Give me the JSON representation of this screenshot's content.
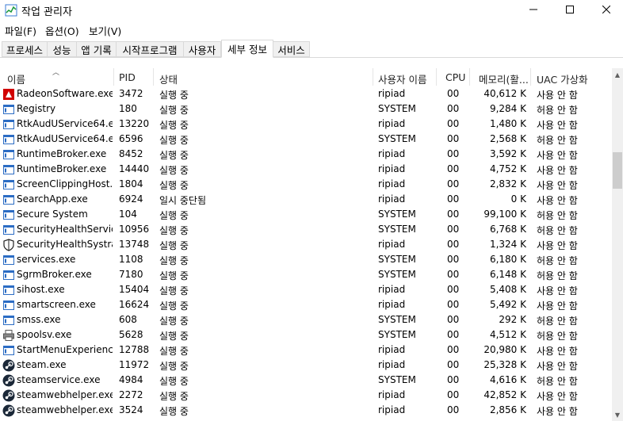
{
  "window": {
    "title": "작업 관리자",
    "minimize_icon": "minimize-icon",
    "maximize_icon": "maximize-icon",
    "close_icon": "close-icon"
  },
  "menu": [
    "파일(F)",
    "옵션(O)",
    "보기(V)"
  ],
  "tabs": [
    "프로세스",
    "성능",
    "앱 기록",
    "시작프로그램",
    "사용자",
    "세부 정보",
    "서비스"
  ],
  "active_tab": "세부 정보",
  "columns": {
    "name": "이름",
    "pid": "PID",
    "status": "상태",
    "user": "사용자 이름",
    "cpu": "CPU",
    "memory": "메모리(활...",
    "uac": "UAC 가상화"
  },
  "rows": [
    {
      "icon": "radeon-icon",
      "name": "RadeonSoftware.exe",
      "pid": "3472",
      "status": "실행 중",
      "user": "ripiad",
      "cpu": "00",
      "memory": "40,612 K",
      "uac": "사용 안 함"
    },
    {
      "icon": "window-icon",
      "name": "Registry",
      "pid": "180",
      "status": "실행 중",
      "user": "SYSTEM",
      "cpu": "00",
      "memory": "9,284 K",
      "uac": "허용 안 함"
    },
    {
      "icon": "window-icon",
      "name": "RtkAudUService64.e...",
      "pid": "13220",
      "status": "실행 중",
      "user": "ripiad",
      "cpu": "00",
      "memory": "1,480 K",
      "uac": "사용 안 함"
    },
    {
      "icon": "window-icon",
      "name": "RtkAudUService64.e...",
      "pid": "6596",
      "status": "실행 중",
      "user": "SYSTEM",
      "cpu": "00",
      "memory": "2,568 K",
      "uac": "허용 안 함"
    },
    {
      "icon": "window-icon",
      "name": "RuntimeBroker.exe",
      "pid": "8452",
      "status": "실행 중",
      "user": "ripiad",
      "cpu": "00",
      "memory": "3,592 K",
      "uac": "사용 안 함"
    },
    {
      "icon": "window-icon",
      "name": "RuntimeBroker.exe",
      "pid": "14440",
      "status": "실행 중",
      "user": "ripiad",
      "cpu": "00",
      "memory": "4,752 K",
      "uac": "사용 안 함"
    },
    {
      "icon": "window-icon",
      "name": "ScreenClippingHost....",
      "pid": "1804",
      "status": "실행 중",
      "user": "ripiad",
      "cpu": "00",
      "memory": "2,832 K",
      "uac": "사용 안 함"
    },
    {
      "icon": "window-icon",
      "name": "SearchApp.exe",
      "pid": "6924",
      "status": "일시 중단됨",
      "user": "ripiad",
      "cpu": "00",
      "memory": "0 K",
      "uac": "사용 안 함"
    },
    {
      "icon": "window-icon",
      "name": "Secure System",
      "pid": "104",
      "status": "실행 중",
      "user": "SYSTEM",
      "cpu": "00",
      "memory": "99,100 K",
      "uac": "허용 안 함"
    },
    {
      "icon": "window-icon",
      "name": "SecurityHealthServic...",
      "pid": "10956",
      "status": "실행 중",
      "user": "SYSTEM",
      "cpu": "00",
      "memory": "6,768 K",
      "uac": "허용 안 함"
    },
    {
      "icon": "shield-icon",
      "name": "SecurityHealthSystra...",
      "pid": "13748",
      "status": "실행 중",
      "user": "ripiad",
      "cpu": "00",
      "memory": "1,324 K",
      "uac": "사용 안 함"
    },
    {
      "icon": "window-icon",
      "name": "services.exe",
      "pid": "1108",
      "status": "실행 중",
      "user": "SYSTEM",
      "cpu": "00",
      "memory": "6,180 K",
      "uac": "허용 안 함"
    },
    {
      "icon": "window-icon",
      "name": "SgrmBroker.exe",
      "pid": "7180",
      "status": "실행 중",
      "user": "SYSTEM",
      "cpu": "00",
      "memory": "6,148 K",
      "uac": "허용 안 함"
    },
    {
      "icon": "window-icon",
      "name": "sihost.exe",
      "pid": "15404",
      "status": "실행 중",
      "user": "ripiad",
      "cpu": "00",
      "memory": "5,408 K",
      "uac": "사용 안 함"
    },
    {
      "icon": "window-icon",
      "name": "smartscreen.exe",
      "pid": "16624",
      "status": "실행 중",
      "user": "ripiad",
      "cpu": "00",
      "memory": "5,492 K",
      "uac": "사용 안 함"
    },
    {
      "icon": "window-icon",
      "name": "smss.exe",
      "pid": "608",
      "status": "실행 중",
      "user": "SYSTEM",
      "cpu": "00",
      "memory": "292 K",
      "uac": "허용 안 함"
    },
    {
      "icon": "printer-icon",
      "name": "spoolsv.exe",
      "pid": "5628",
      "status": "실행 중",
      "user": "SYSTEM",
      "cpu": "00",
      "memory": "4,512 K",
      "uac": "허용 안 함"
    },
    {
      "icon": "window-icon",
      "name": "StartMenuExperienc...",
      "pid": "12788",
      "status": "실행 중",
      "user": "ripiad",
      "cpu": "00",
      "memory": "20,980 K",
      "uac": "사용 안 함"
    },
    {
      "icon": "steam-icon",
      "name": "steam.exe",
      "pid": "11972",
      "status": "실행 중",
      "user": "ripiad",
      "cpu": "00",
      "memory": "25,328 K",
      "uac": "사용 안 함"
    },
    {
      "icon": "steam-icon",
      "name": "steamservice.exe",
      "pid": "4984",
      "status": "실행 중",
      "user": "SYSTEM",
      "cpu": "00",
      "memory": "4,616 K",
      "uac": "허용 안 함"
    },
    {
      "icon": "steam-icon",
      "name": "steamwebhelper.exe",
      "pid": "2272",
      "status": "실행 중",
      "user": "ripiad",
      "cpu": "00",
      "memory": "42,852 K",
      "uac": "사용 안 함"
    },
    {
      "icon": "steam-icon",
      "name": "steamwebhelper.exe",
      "pid": "3524",
      "status": "실행 중",
      "user": "ripiad",
      "cpu": "00",
      "memory": "2,856 K",
      "uac": "사용 안 함"
    }
  ],
  "colors": {
    "radeon": "#d10000",
    "window_icon_blue": "#2b6cc4",
    "steam": "#1b2838"
  }
}
